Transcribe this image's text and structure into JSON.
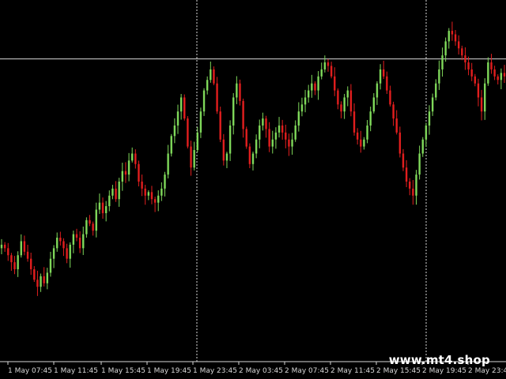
{
  "watermark": {
    "text": "www.mt4.shop"
  },
  "colors": {
    "background": "#000000",
    "bull_candle": "#7fd85a",
    "bear_candle": "#e21e1e",
    "grid": "#d8d8d8",
    "axis_text": "#d8d8d8"
  },
  "chart_data": {
    "type": "candlestick",
    "title": "",
    "xlabel": "",
    "ylabel": "",
    "grid": false,
    "ylim": [
      0,
      100
    ],
    "x_tick_labels": [
      "1 May 07:45",
      "1 May 11:45",
      "1 May 15:45",
      "1 May 19:45",
      "1 May 23:45",
      "2 May 03:45",
      "2 May 07:45",
      "2 May 11:45",
      "2 May 15:45",
      "2 May 19:45",
      "2 May 23:45"
    ],
    "period_separators": [
      "1 May 23:45",
      "2 May 19:45"
    ],
    "horizontal_line": 85,
    "close_series": [
      32,
      31,
      29,
      27,
      25,
      29,
      33,
      30,
      28,
      25,
      22,
      20,
      23,
      21,
      24,
      28,
      31,
      34,
      33,
      31,
      28,
      32,
      35,
      34,
      31,
      35,
      39,
      38,
      36,
      42,
      44,
      41,
      43,
      46,
      48,
      45,
      50,
      53,
      52,
      56,
      58,
      55,
      50,
      48,
      46,
      47,
      45,
      44,
      46,
      48,
      52,
      58,
      63,
      66,
      70,
      74,
      68,
      60,
      54,
      59,
      64,
      70,
      76,
      79,
      82,
      78,
      70,
      62,
      56,
      58,
      66,
      74,
      78,
      73,
      65,
      60,
      55,
      58,
      62,
      66,
      68,
      65,
      60,
      62,
      64,
      66,
      64,
      62,
      60,
      62,
      66,
      70,
      72,
      74,
      76,
      78,
      76,
      80,
      82,
      84,
      83,
      80,
      76,
      72,
      70,
      74,
      76,
      70,
      64,
      62,
      60,
      62,
      66,
      70,
      74,
      78,
      82,
      80,
      76,
      72,
      68,
      64,
      58,
      54,
      50,
      48,
      46,
      52,
      58,
      62,
      66,
      70,
      74,
      78,
      82,
      86,
      90,
      93,
      92,
      90,
      88,
      86,
      84,
      82,
      80,
      78,
      74,
      70,
      78,
      84,
      82,
      80,
      79,
      81,
      80
    ]
  }
}
